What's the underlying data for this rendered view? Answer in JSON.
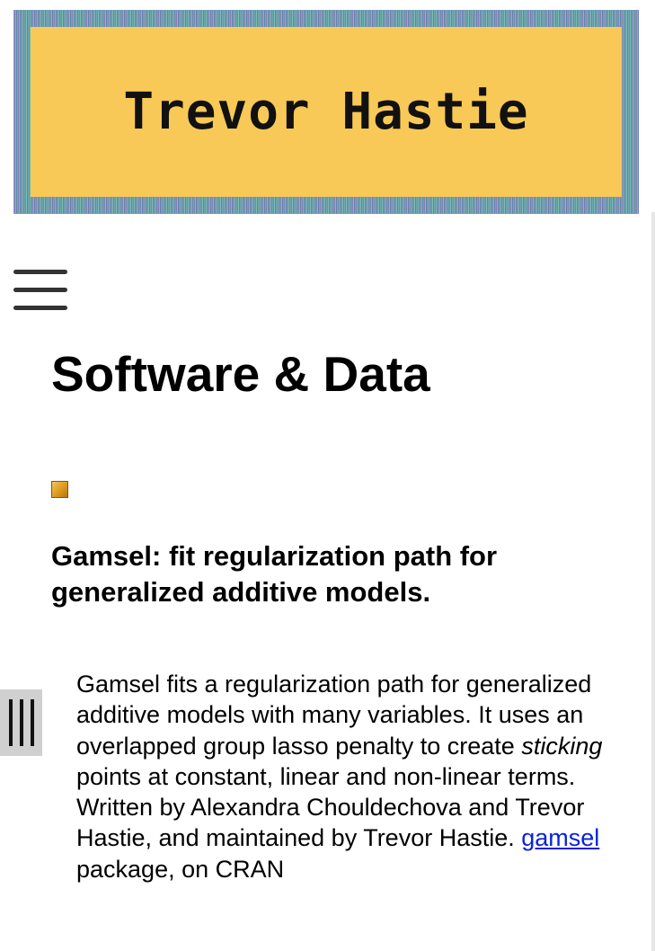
{
  "banner": {
    "title": "Trevor Hastie"
  },
  "nav": {
    "menu_icon": "hamburger-menu-icon",
    "side_handle_icon": "vertical-bars-icon"
  },
  "page": {
    "title": "Software & Data"
  },
  "entries": [
    {
      "bullet_icon": "gold-square-icon",
      "title": "Gamsel: fit regularization path for generalized additive models.",
      "description": {
        "part1": "Gamsel fits a regularization path for generalized additive models with many variables. It uses an overlapped group lasso penalty to create ",
        "emphasis": "sticking",
        "part2": " points at constant, linear and non-linear terms. Written by Alexandra Chouldechova and Trevor Hastie, and maintained by Trevor Hastie. ",
        "link_text": "gamsel",
        "part3": " package, on CRAN"
      }
    }
  ],
  "colors": {
    "banner_fill": "#f8c956",
    "link": "#0b22d8",
    "hamburger": "#333333"
  }
}
